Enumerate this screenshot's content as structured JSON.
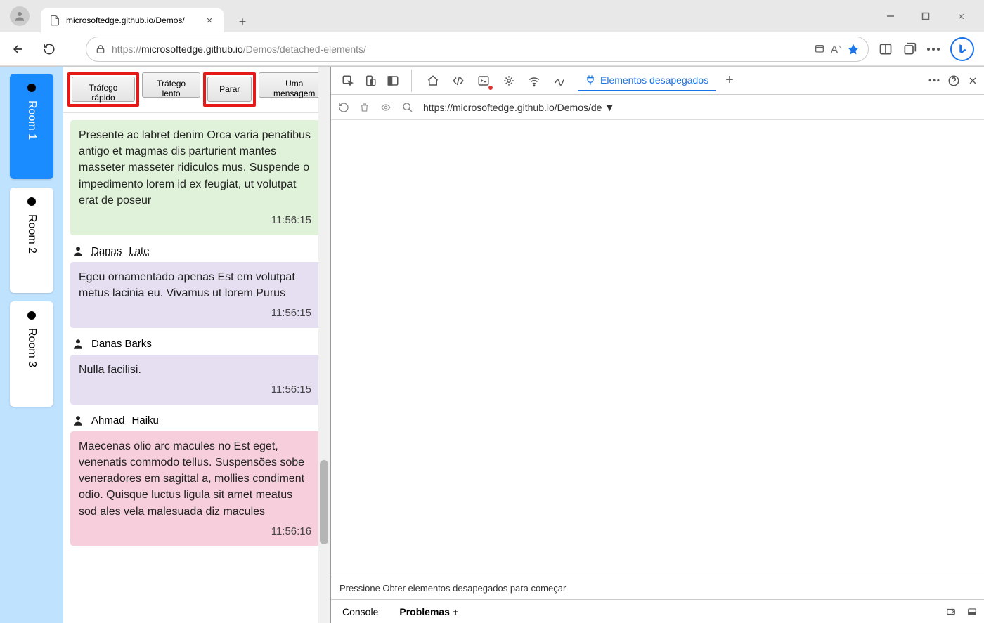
{
  "browser": {
    "tab_title": "microsoftedge.github.io/Demos/",
    "url_display_prefix": "https://",
    "url_display_host": "microsoftedge.github.io",
    "url_display_path": "/Demos/detached-elements/"
  },
  "rooms": [
    {
      "label": "Room 1",
      "active": true
    },
    {
      "label": "Room 2",
      "active": false
    },
    {
      "label": "Room 3",
      "active": false
    }
  ],
  "chat_toolbar": {
    "fast_traffic": "Tráfego rápido",
    "slow_traffic": "Tráfego lento",
    "stop": "Parar",
    "one_message": "Uma mensagem"
  },
  "messages": [
    {
      "author_first": "",
      "author_last": "",
      "color": "green",
      "text": "Presente ac labret denim        Orca varia penatibus antigo et magmas dis parturient mantes masseter masseter ridiculos mus. Suspende o impedimento lorem id ex feugiat, ut volutpat erat de poseur",
      "time": "11:56:15"
    },
    {
      "author_first": "Danas",
      "author_last": "Late",
      "color": "purple",
      "text": "Egeu ornamentado apenas Est em volutpat metus lacinia eu. Vivamus ut lorem Purus",
      "time": "11:56:15"
    },
    {
      "author_first": "Danas Barks",
      "author_last": "",
      "color": "purple",
      "text": "Nulla facilisi.",
      "time": "11:56:15"
    },
    {
      "author_first": "Ahmad",
      "author_last": "Haiku",
      "color": "pink",
      "text": "Maecenas olio arc macules no Est eget, venenatis commodo tellus. Suspensões sobe veneradores em sagittal a, mollies condiment odio. Quisque luctus ligula sit amet meatus sod ales vela malesuada diz macules",
      "time": "11:56:16"
    }
  ],
  "devtools": {
    "active_tab": "Elementos desapegados",
    "sub_url": "https://microsoftedge.github.io/Demos/de",
    "status_hint": "Pressione Obter elementos desapegados para começar",
    "console_label": "Console",
    "problems_label": "Problemas",
    "problems_plus": "+"
  }
}
